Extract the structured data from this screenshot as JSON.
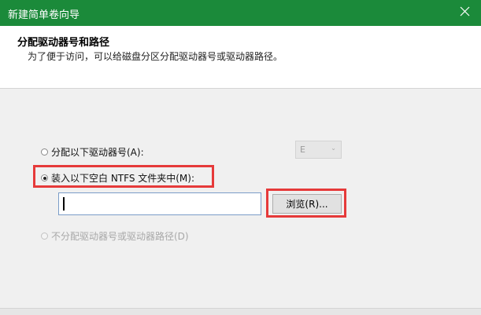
{
  "window": {
    "title": "新建简单卷向导"
  },
  "header": {
    "title": "分配驱动器号和路径",
    "subtitle": "为了便于访问，可以给磁盘分区分配驱动器号或驱动器路径。"
  },
  "options": {
    "assign_letter": {
      "label": "分配以下驱动器号(A):",
      "selected": false,
      "enabled": true
    },
    "mount_folder": {
      "label": "装入以下空白 NTFS 文件夹中(M):",
      "selected": true,
      "enabled": true
    },
    "no_assign": {
      "label": "不分配驱动器号或驱动器路径(D)",
      "selected": false,
      "enabled": false
    }
  },
  "drive_letter": {
    "value": "E",
    "enabled": false
  },
  "folder_path": {
    "value": ""
  },
  "browse_button": {
    "label": "浏览(R)..."
  },
  "colors": {
    "titlebar": "#1b8a3a",
    "highlight": "#e63a3a"
  },
  "icons": {
    "close": "close-icon",
    "dropdown": "chevron-down-icon"
  }
}
